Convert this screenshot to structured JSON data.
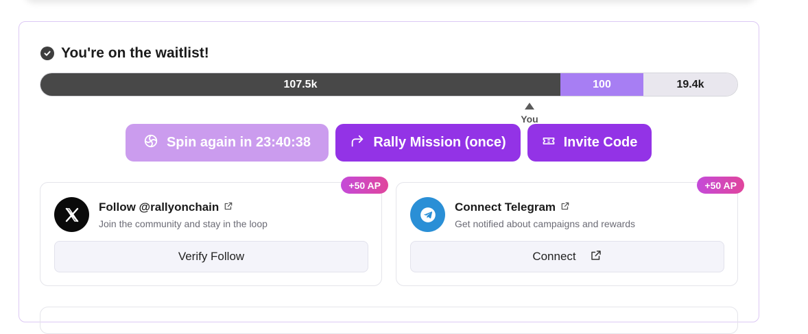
{
  "waitlist": {
    "title": "You're on the waitlist!",
    "progress": {
      "ahead_label": "107.5k",
      "window_label": "100",
      "behind_label": "19.4k",
      "you_label": "You"
    }
  },
  "actions": {
    "spin_label": "Spin again in 23:40:38",
    "rally_label": "Rally Mission (once)",
    "invite_label": "Invite Code"
  },
  "tasks": [
    {
      "badge": "+50 AP",
      "title": "Follow @rallyonchain",
      "description": "Join the community and stay in the loop",
      "button": "Verify Follow"
    },
    {
      "badge": "+50 AP",
      "title": "Connect Telegram",
      "description": "Get notified about campaigns and rewards",
      "button": "Connect"
    }
  ],
  "colors": {
    "accent_purple": "#9333e6",
    "spin_disabled": "#cb9cee",
    "progress_ahead": "#484848",
    "progress_window": "#a77ef3",
    "progress_behind": "#e9e7ee",
    "badge_gradient": [
      "#c44ad9",
      "#e0459c"
    ],
    "telegram_blue": "#2a8fd6"
  },
  "icons": {
    "check": "check-circle-icon",
    "spin": "spin-wheel-icon",
    "rally": "share-arrow-icon",
    "invite": "ticket-icon",
    "x_logo": "x-logo-icon",
    "telegram": "telegram-icon",
    "external": "external-link-icon"
  }
}
